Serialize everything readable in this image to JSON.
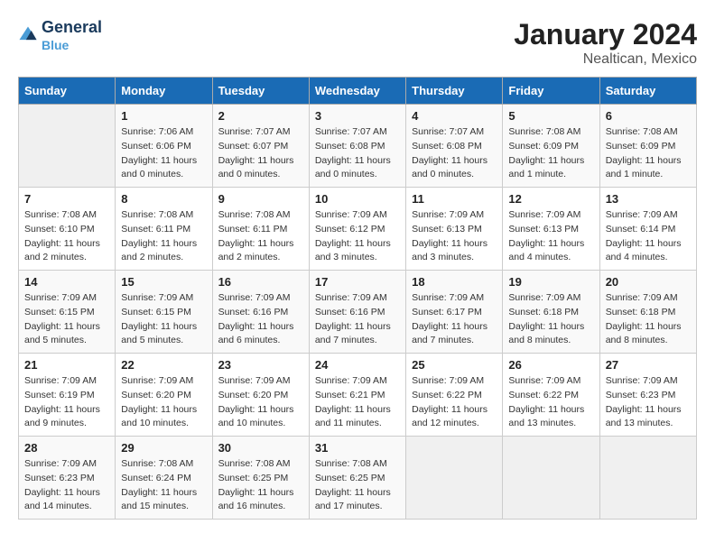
{
  "logo": {
    "line1": "General",
    "line2": "Blue"
  },
  "title": "January 2024",
  "subtitle": "Nealtican, Mexico",
  "header_days": [
    "Sunday",
    "Monday",
    "Tuesday",
    "Wednesday",
    "Thursday",
    "Friday",
    "Saturday"
  ],
  "weeks": [
    [
      {
        "day": "",
        "sunrise": "",
        "sunset": "",
        "daylight": ""
      },
      {
        "day": "1",
        "sunrise": "Sunrise: 7:06 AM",
        "sunset": "Sunset: 6:06 PM",
        "daylight": "Daylight: 11 hours and 0 minutes."
      },
      {
        "day": "2",
        "sunrise": "Sunrise: 7:07 AM",
        "sunset": "Sunset: 6:07 PM",
        "daylight": "Daylight: 11 hours and 0 minutes."
      },
      {
        "day": "3",
        "sunrise": "Sunrise: 7:07 AM",
        "sunset": "Sunset: 6:08 PM",
        "daylight": "Daylight: 11 hours and 0 minutes."
      },
      {
        "day": "4",
        "sunrise": "Sunrise: 7:07 AM",
        "sunset": "Sunset: 6:08 PM",
        "daylight": "Daylight: 11 hours and 0 minutes."
      },
      {
        "day": "5",
        "sunrise": "Sunrise: 7:08 AM",
        "sunset": "Sunset: 6:09 PM",
        "daylight": "Daylight: 11 hours and 1 minute."
      },
      {
        "day": "6",
        "sunrise": "Sunrise: 7:08 AM",
        "sunset": "Sunset: 6:09 PM",
        "daylight": "Daylight: 11 hours and 1 minute."
      }
    ],
    [
      {
        "day": "7",
        "sunrise": "Sunrise: 7:08 AM",
        "sunset": "Sunset: 6:10 PM",
        "daylight": "Daylight: 11 hours and 2 minutes."
      },
      {
        "day": "8",
        "sunrise": "Sunrise: 7:08 AM",
        "sunset": "Sunset: 6:11 PM",
        "daylight": "Daylight: 11 hours and 2 minutes."
      },
      {
        "day": "9",
        "sunrise": "Sunrise: 7:08 AM",
        "sunset": "Sunset: 6:11 PM",
        "daylight": "Daylight: 11 hours and 2 minutes."
      },
      {
        "day": "10",
        "sunrise": "Sunrise: 7:09 AM",
        "sunset": "Sunset: 6:12 PM",
        "daylight": "Daylight: 11 hours and 3 minutes."
      },
      {
        "day": "11",
        "sunrise": "Sunrise: 7:09 AM",
        "sunset": "Sunset: 6:13 PM",
        "daylight": "Daylight: 11 hours and 3 minutes."
      },
      {
        "day": "12",
        "sunrise": "Sunrise: 7:09 AM",
        "sunset": "Sunset: 6:13 PM",
        "daylight": "Daylight: 11 hours and 4 minutes."
      },
      {
        "day": "13",
        "sunrise": "Sunrise: 7:09 AM",
        "sunset": "Sunset: 6:14 PM",
        "daylight": "Daylight: 11 hours and 4 minutes."
      }
    ],
    [
      {
        "day": "14",
        "sunrise": "Sunrise: 7:09 AM",
        "sunset": "Sunset: 6:15 PM",
        "daylight": "Daylight: 11 hours and 5 minutes."
      },
      {
        "day": "15",
        "sunrise": "Sunrise: 7:09 AM",
        "sunset": "Sunset: 6:15 PM",
        "daylight": "Daylight: 11 hours and 5 minutes."
      },
      {
        "day": "16",
        "sunrise": "Sunrise: 7:09 AM",
        "sunset": "Sunset: 6:16 PM",
        "daylight": "Daylight: 11 hours and 6 minutes."
      },
      {
        "day": "17",
        "sunrise": "Sunrise: 7:09 AM",
        "sunset": "Sunset: 6:16 PM",
        "daylight": "Daylight: 11 hours and 7 minutes."
      },
      {
        "day": "18",
        "sunrise": "Sunrise: 7:09 AM",
        "sunset": "Sunset: 6:17 PM",
        "daylight": "Daylight: 11 hours and 7 minutes."
      },
      {
        "day": "19",
        "sunrise": "Sunrise: 7:09 AM",
        "sunset": "Sunset: 6:18 PM",
        "daylight": "Daylight: 11 hours and 8 minutes."
      },
      {
        "day": "20",
        "sunrise": "Sunrise: 7:09 AM",
        "sunset": "Sunset: 6:18 PM",
        "daylight": "Daylight: 11 hours and 8 minutes."
      }
    ],
    [
      {
        "day": "21",
        "sunrise": "Sunrise: 7:09 AM",
        "sunset": "Sunset: 6:19 PM",
        "daylight": "Daylight: 11 hours and 9 minutes."
      },
      {
        "day": "22",
        "sunrise": "Sunrise: 7:09 AM",
        "sunset": "Sunset: 6:20 PM",
        "daylight": "Daylight: 11 hours and 10 minutes."
      },
      {
        "day": "23",
        "sunrise": "Sunrise: 7:09 AM",
        "sunset": "Sunset: 6:20 PM",
        "daylight": "Daylight: 11 hours and 10 minutes."
      },
      {
        "day": "24",
        "sunrise": "Sunrise: 7:09 AM",
        "sunset": "Sunset: 6:21 PM",
        "daylight": "Daylight: 11 hours and 11 minutes."
      },
      {
        "day": "25",
        "sunrise": "Sunrise: 7:09 AM",
        "sunset": "Sunset: 6:22 PM",
        "daylight": "Daylight: 11 hours and 12 minutes."
      },
      {
        "day": "26",
        "sunrise": "Sunrise: 7:09 AM",
        "sunset": "Sunset: 6:22 PM",
        "daylight": "Daylight: 11 hours and 13 minutes."
      },
      {
        "day": "27",
        "sunrise": "Sunrise: 7:09 AM",
        "sunset": "Sunset: 6:23 PM",
        "daylight": "Daylight: 11 hours and 13 minutes."
      }
    ],
    [
      {
        "day": "28",
        "sunrise": "Sunrise: 7:09 AM",
        "sunset": "Sunset: 6:23 PM",
        "daylight": "Daylight: 11 hours and 14 minutes."
      },
      {
        "day": "29",
        "sunrise": "Sunrise: 7:08 AM",
        "sunset": "Sunset: 6:24 PM",
        "daylight": "Daylight: 11 hours and 15 minutes."
      },
      {
        "day": "30",
        "sunrise": "Sunrise: 7:08 AM",
        "sunset": "Sunset: 6:25 PM",
        "daylight": "Daylight: 11 hours and 16 minutes."
      },
      {
        "day": "31",
        "sunrise": "Sunrise: 7:08 AM",
        "sunset": "Sunset: 6:25 PM",
        "daylight": "Daylight: 11 hours and 17 minutes."
      },
      {
        "day": "",
        "sunrise": "",
        "sunset": "",
        "daylight": ""
      },
      {
        "day": "",
        "sunrise": "",
        "sunset": "",
        "daylight": ""
      },
      {
        "day": "",
        "sunrise": "",
        "sunset": "",
        "daylight": ""
      }
    ]
  ]
}
